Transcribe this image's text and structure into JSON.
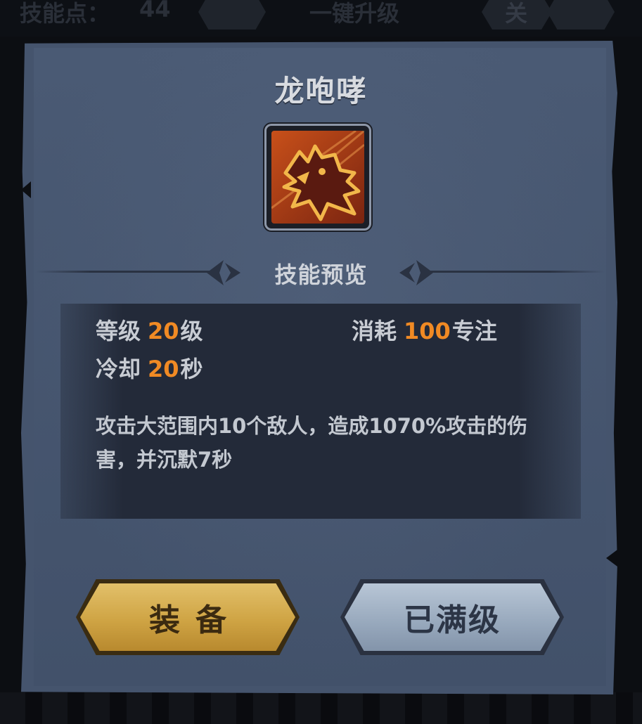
{
  "topbar": {
    "skill_points_label": "技能点：",
    "skill_points_value": "44",
    "one_click_upgrade": "一键升级",
    "close_label": "关"
  },
  "dialog": {
    "skill_name": "龙咆哮",
    "skill_icon": "dragon-roar-icon",
    "section_title": "技能预览",
    "stats": {
      "level_label": "等级",
      "level_value": "20",
      "level_unit": "级",
      "cost_label": "消耗",
      "cost_value": "100",
      "cost_unit": "专注",
      "cooldown_label": "冷却",
      "cooldown_value": "20",
      "cooldown_unit": "秒"
    },
    "description": "攻击大范围内10个敌人，造成1070%攻击的伤害，并沉默7秒",
    "buttons": {
      "equip": "装备",
      "maxed": "已满级"
    }
  },
  "colors": {
    "panel": "#45546d",
    "highlight_number": "#f08a24",
    "equip_button": "#cfa444",
    "maxed_button": "#97a8bc"
  }
}
